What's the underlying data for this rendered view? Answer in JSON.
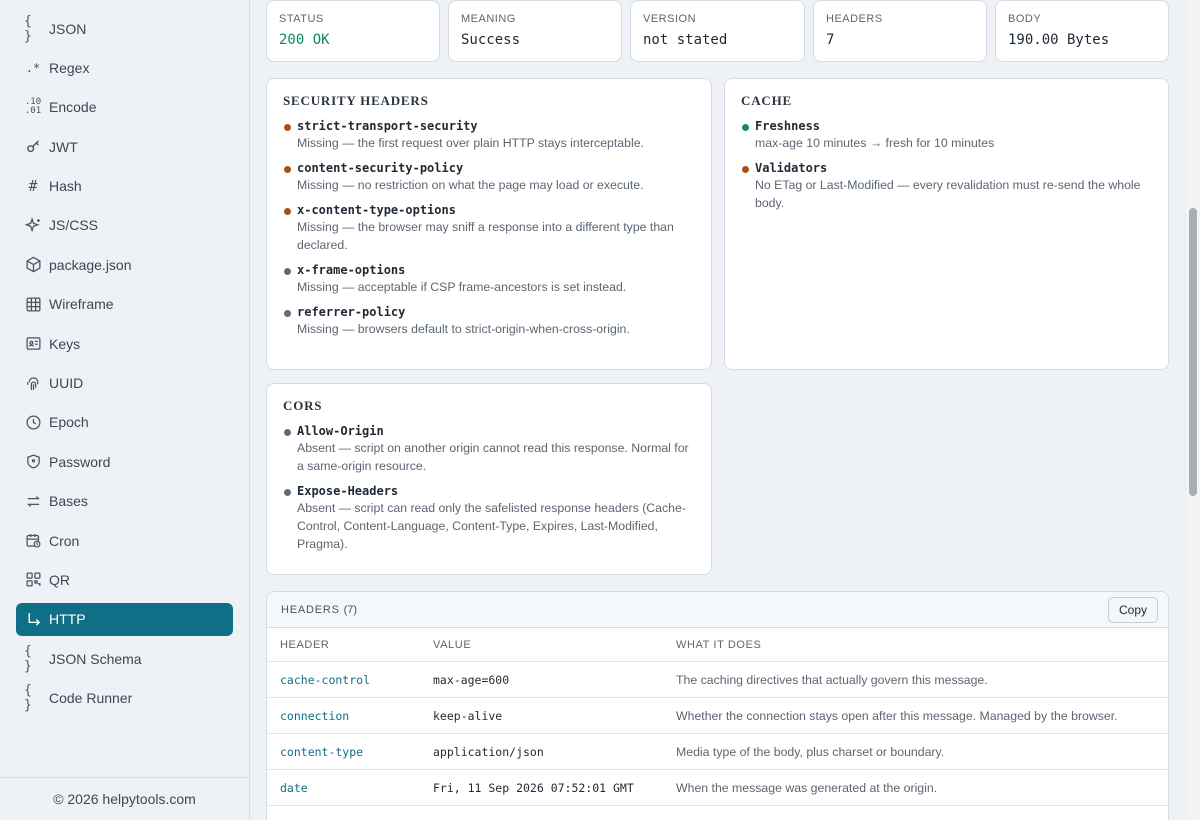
{
  "sidebar": {
    "items": [
      {
        "label": "JSON",
        "icon": "braces-icon"
      },
      {
        "label": "Regex",
        "icon": "regex-icon"
      },
      {
        "label": "Encode",
        "icon": "binary-icon"
      },
      {
        "label": "JWT",
        "icon": "key-icon"
      },
      {
        "label": "Hash",
        "icon": "hash-icon"
      },
      {
        "label": "JS/CSS",
        "icon": "sparkles-icon"
      },
      {
        "label": "package.json",
        "icon": "package-icon"
      },
      {
        "label": "Wireframe",
        "icon": "grid-icon"
      },
      {
        "label": "Keys",
        "icon": "id-card-icon"
      },
      {
        "label": "UUID",
        "icon": "fingerprint-icon"
      },
      {
        "label": "Epoch",
        "icon": "clock-icon"
      },
      {
        "label": "Password",
        "icon": "shield-icon"
      },
      {
        "label": "Bases",
        "icon": "arrows-icon"
      },
      {
        "label": "Cron",
        "icon": "calendar-clock-icon"
      },
      {
        "label": "QR",
        "icon": "qr-icon"
      },
      {
        "label": "HTTP",
        "icon": "corner-arrow-icon",
        "active": true
      },
      {
        "label": "JSON Schema",
        "icon": "braces-icon"
      },
      {
        "label": "Code Runner",
        "icon": "braces-icon"
      }
    ],
    "footer": "© 2026 helpytools.com",
    "active_color": "#0e6f86"
  },
  "stats": [
    {
      "label": "STATUS",
      "value": "200 OK"
    },
    {
      "label": "MEANING",
      "value": "Success"
    },
    {
      "label": "VERSION",
      "value": "not stated"
    },
    {
      "label": "HEADERS",
      "value": "7"
    },
    {
      "label": "BODY",
      "value": "190.00 Bytes"
    }
  ],
  "security": {
    "title": "SECURITY HEADERS",
    "items": [
      {
        "key": "strict-transport-security",
        "desc": "Missing — the first request over plain HTTP stays interceptable.",
        "status": "warn"
      },
      {
        "key": "content-security-policy",
        "desc": "Missing — no restriction on what the page may load or execute.",
        "status": "warn"
      },
      {
        "key": "x-content-type-options",
        "desc": "Missing — the browser may sniff a response into a different type than declared.",
        "status": "warn"
      },
      {
        "key": "x-frame-options",
        "desc": "Missing — acceptable if CSP frame-ancestors is set instead.",
        "status": "info"
      },
      {
        "key": "referrer-policy",
        "desc": "Missing — browsers default to strict-origin-when-cross-origin.",
        "status": "info"
      }
    ]
  },
  "cache": {
    "title": "CACHE",
    "items": [
      {
        "key": "Freshness",
        "desc": "max-age 10 minutes → fresh for 10 minutes",
        "status": "ok"
      },
      {
        "key": "Validators",
        "desc": "No ETag or Last-Modified — every revalidation must re-send the whole body.",
        "status": "warn"
      }
    ]
  },
  "cors": {
    "title": "CORS",
    "items": [
      {
        "key": "Allow-Origin",
        "desc": "Absent — script on another origin cannot read this response. Normal for a same-origin resource.",
        "status": "info"
      },
      {
        "key": "Expose-Headers",
        "desc": "Absent — script can read only the safelisted response headers (Cache-Control, Content-Language, Content-Type, Expires, Last-Modified, Pragma).",
        "status": "info"
      }
    ]
  },
  "status_colors": {
    "ok": "#1f8a54",
    "warn": "#a4501b",
    "info": "#5f6b7e"
  },
  "headers_table": {
    "title": "HEADERS",
    "count": "(7)",
    "copy_label": "Copy",
    "columns": [
      "HEADER",
      "VALUE",
      "WHAT IT DOES"
    ],
    "rows": [
      {
        "name": "cache-control",
        "value": "max-age=600",
        "desc": "The caching directives that actually govern this message."
      },
      {
        "name": "connection",
        "value": "keep-alive",
        "desc": "Whether the connection stays open after this message. Managed by the browser."
      },
      {
        "name": "content-type",
        "value": "application/json",
        "desc": "Media type of the body, plus charset or boundary."
      },
      {
        "name": "date",
        "value": "Fri, 11 Sep 2026 07:52:01 GMT",
        "desc": "When the message was generated at the origin."
      }
    ]
  }
}
